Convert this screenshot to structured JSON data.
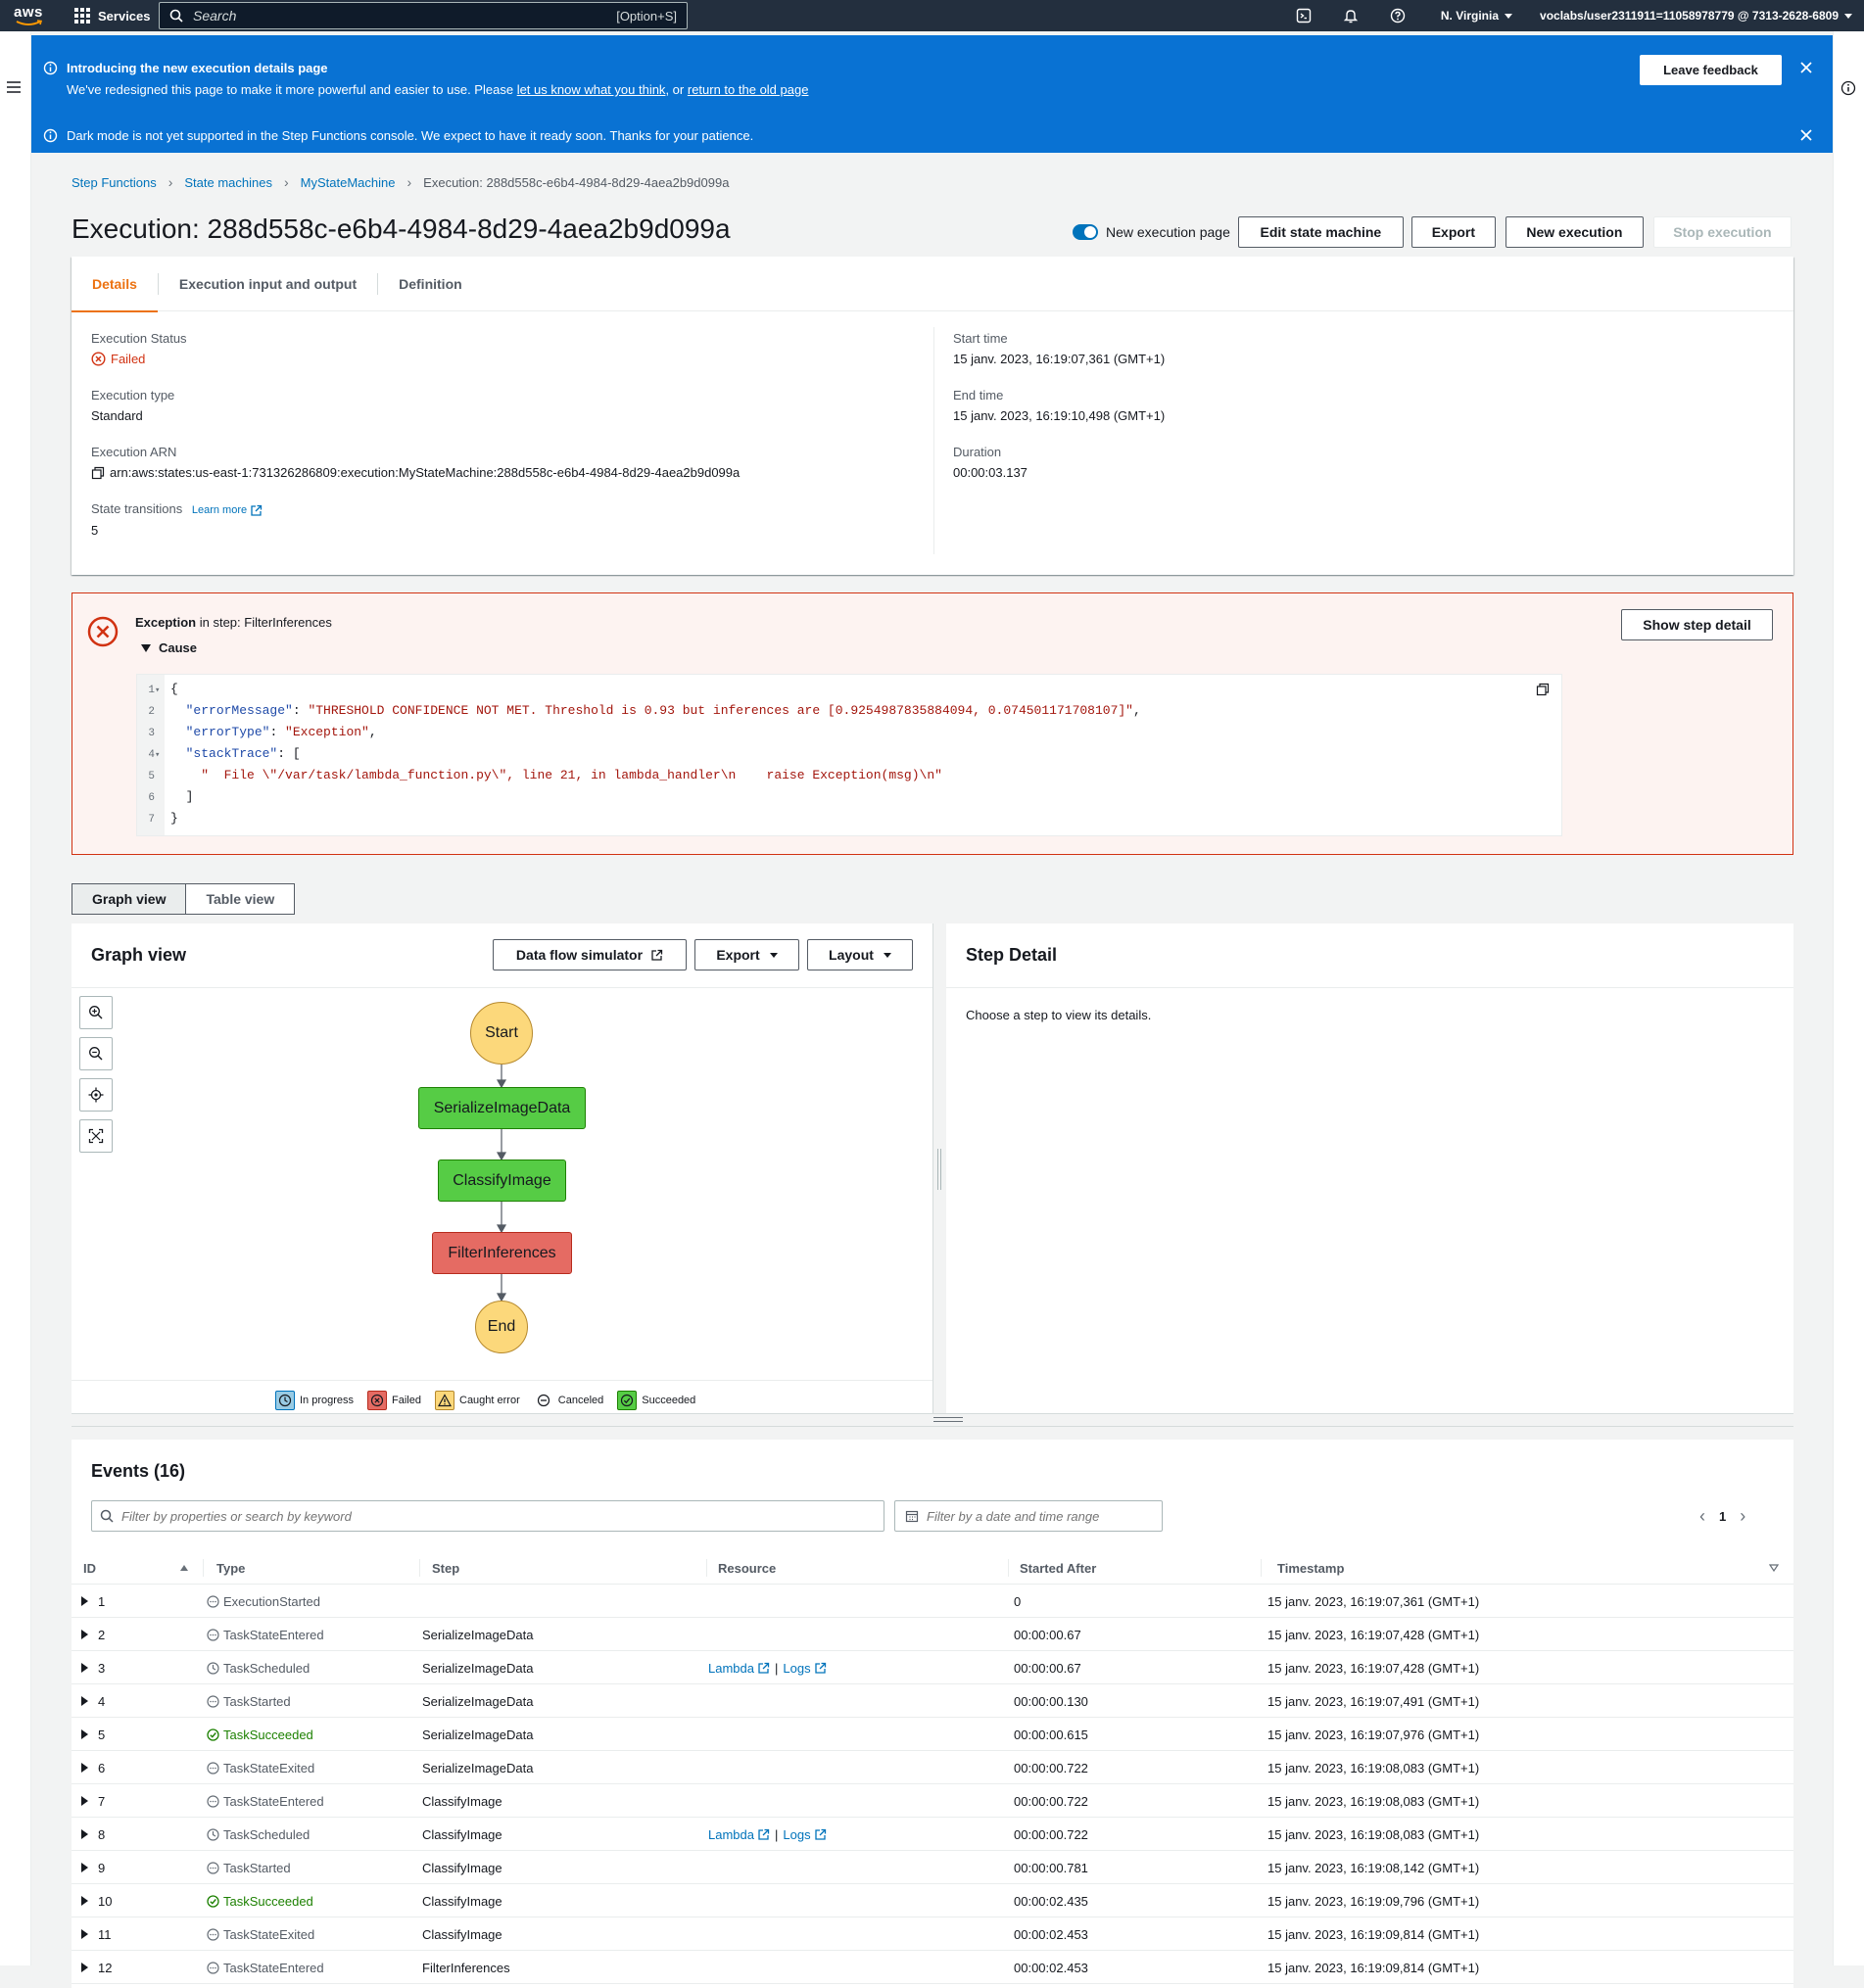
{
  "topnav": {
    "logo_text": "aws",
    "services_label": "Services",
    "search_placeholder": "Search",
    "search_shortcut": "[Option+S]",
    "region": "N. Virginia",
    "account": "voclabs/user2311911=11058978779 @ 7313-2628-6809"
  },
  "banners": {
    "intro_title": "Introducing the new execution details page",
    "intro_text": "We've redesigned this page to make it more powerful and easier to use. Please",
    "intro_link1": "let us know what you think",
    "intro_mid": ", or",
    "intro_link2": "return to the old page",
    "leave_feedback": "Leave feedback",
    "dark_mode_text": "Dark mode is not yet supported in the Step Functions console. We expect to have it ready soon. Thanks for your patience."
  },
  "breadcrumb": {
    "items": [
      "Step Functions",
      "State machines",
      "MyStateMachine"
    ],
    "current": "Execution: 288d558c-e6b4-4984-8d29-4aea2b9d099a"
  },
  "page": {
    "title": "Execution: 288d558c-e6b4-4984-8d29-4aea2b9d099a",
    "toggle_label": "New execution page",
    "edit_button": "Edit state machine",
    "export_button": "Export",
    "new_execution_button": "New execution",
    "stop_execution_button": "Stop execution"
  },
  "details": {
    "tabs": [
      "Details",
      "Execution input and output",
      "Definition"
    ],
    "status_label": "Execution Status",
    "status_value": "Failed",
    "type_label": "Execution type",
    "type_value": "Standard",
    "arn_label": "Execution ARN",
    "arn_value": "arn:aws:states:us-east-1:731326286809:execution:MyStateMachine:288d558c-e6b4-4984-8d29-4aea2b9d099a",
    "transitions_label": "State transitions",
    "learn_more": "Learn more",
    "transitions_value": "5",
    "start_label": "Start time",
    "start_value": "15 janv. 2023, 16:19:07,361 (GMT+1)",
    "end_label": "End time",
    "end_value": "15 janv. 2023, 16:19:10,498 (GMT+1)",
    "duration_label": "Duration",
    "duration_value": "00:00:03.137"
  },
  "exception": {
    "title_bold": "Exception",
    "title_rest": " in step: FilterInferences",
    "cause_label": "Cause",
    "show_step_detail": "Show step detail",
    "code_lines": [
      {
        "n": "1",
        "fold": "▾",
        "parts": [
          {
            "t": "{",
            "c": ""
          }
        ]
      },
      {
        "n": "2",
        "fold": "",
        "parts": [
          {
            "t": "  ",
            "c": ""
          },
          {
            "t": "\"errorMessage\"",
            "c": "key"
          },
          {
            "t": ": ",
            "c": ""
          },
          {
            "t": "\"THRESHOLD CONFIDENCE NOT MET. Threshold is 0.93 but inferences are [0.9254987835884094, 0.074501171708107]\"",
            "c": "str"
          },
          {
            "t": ",",
            "c": ""
          }
        ]
      },
      {
        "n": "3",
        "fold": "",
        "parts": [
          {
            "t": "  ",
            "c": ""
          },
          {
            "t": "\"errorType\"",
            "c": "key"
          },
          {
            "t": ": ",
            "c": ""
          },
          {
            "t": "\"Exception\"",
            "c": "str"
          },
          {
            "t": ",",
            "c": ""
          }
        ]
      },
      {
        "n": "4",
        "fold": "▾",
        "parts": [
          {
            "t": "  ",
            "c": ""
          },
          {
            "t": "\"stackTrace\"",
            "c": "key"
          },
          {
            "t": ": [",
            "c": ""
          }
        ]
      },
      {
        "n": "5",
        "fold": "",
        "parts": [
          {
            "t": "    ",
            "c": ""
          },
          {
            "t": "\"  File \\\"/var/task/lambda_function.py\\\", line 21, in lambda_handler\\n    raise Exception(msg)\\n\"",
            "c": "str"
          }
        ]
      },
      {
        "n": "6",
        "fold": "",
        "parts": [
          {
            "t": "  ]",
            "c": ""
          }
        ]
      },
      {
        "n": "7",
        "fold": "",
        "parts": [
          {
            "t": "}",
            "c": ""
          }
        ]
      }
    ]
  },
  "view_toggle": [
    "Graph view",
    "Table view"
  ],
  "graph": {
    "title": "Graph view",
    "data_flow_button": "Data flow simulator",
    "export_button": "Export",
    "layout_button": "Layout",
    "nodes": [
      {
        "label": "Start",
        "status": "terminal"
      },
      {
        "label": "SerializeImageData",
        "status": "succeeded"
      },
      {
        "label": "ClassifyImage",
        "status": "succeeded"
      },
      {
        "label": "FilterInferences",
        "status": "failed"
      },
      {
        "label": "End",
        "status": "terminal"
      }
    ],
    "legend": [
      "In progress",
      "Failed",
      "Caught error",
      "Canceled",
      "Succeeded"
    ]
  },
  "step_detail": {
    "title": "Step Detail",
    "empty_text": "Choose a step to view its details."
  },
  "events": {
    "title": "Events (16)",
    "filter_placeholder": "Filter by properties or search by keyword",
    "date_placeholder": "Filter by a date and time range",
    "page_number": "1",
    "columns": [
      "ID",
      "Type",
      "Step",
      "Resource",
      "Started After",
      "Timestamp"
    ],
    "resource_lambda": "Lambda",
    "resource_logs": "Logs",
    "rows": [
      {
        "id": "1",
        "type": "ExecutionStarted",
        "status": "neutral",
        "step": "",
        "resource": false,
        "after": "0",
        "ts": "15 janv. 2023, 16:19:07,361 (GMT+1)"
      },
      {
        "id": "2",
        "type": "TaskStateEntered",
        "status": "neutral",
        "step": "SerializeImageData",
        "resource": false,
        "after": "00:00:00.67",
        "ts": "15 janv. 2023, 16:19:07,428 (GMT+1)"
      },
      {
        "id": "3",
        "type": "TaskScheduled",
        "status": "clock",
        "step": "SerializeImageData",
        "resource": true,
        "after": "00:00:00.67",
        "ts": "15 janv. 2023, 16:19:07,428 (GMT+1)"
      },
      {
        "id": "4",
        "type": "TaskStarted",
        "status": "neutral",
        "step": "SerializeImageData",
        "resource": false,
        "after": "00:00:00.130",
        "ts": "15 janv. 2023, 16:19:07,491 (GMT+1)"
      },
      {
        "id": "5",
        "type": "TaskSucceeded",
        "status": "success",
        "step": "SerializeImageData",
        "resource": false,
        "after": "00:00:00.615",
        "ts": "15 janv. 2023, 16:19:07,976 (GMT+1)"
      },
      {
        "id": "6",
        "type": "TaskStateExited",
        "status": "neutral",
        "step": "SerializeImageData",
        "resource": false,
        "after": "00:00:00.722",
        "ts": "15 janv. 2023, 16:19:08,083 (GMT+1)"
      },
      {
        "id": "7",
        "type": "TaskStateEntered",
        "status": "neutral",
        "step": "ClassifyImage",
        "resource": false,
        "after": "00:00:00.722",
        "ts": "15 janv. 2023, 16:19:08,083 (GMT+1)"
      },
      {
        "id": "8",
        "type": "TaskScheduled",
        "status": "clock",
        "step": "ClassifyImage",
        "resource": true,
        "after": "00:00:00.722",
        "ts": "15 janv. 2023, 16:19:08,083 (GMT+1)"
      },
      {
        "id": "9",
        "type": "TaskStarted",
        "status": "neutral",
        "step": "ClassifyImage",
        "resource": false,
        "after": "00:00:00.781",
        "ts": "15 janv. 2023, 16:19:08,142 (GMT+1)"
      },
      {
        "id": "10",
        "type": "TaskSucceeded",
        "status": "success",
        "step": "ClassifyImage",
        "resource": false,
        "after": "00:00:02.435",
        "ts": "15 janv. 2023, 16:19:09,796 (GMT+1)"
      },
      {
        "id": "11",
        "type": "TaskStateExited",
        "status": "neutral",
        "step": "ClassifyImage",
        "resource": false,
        "after": "00:00:02.453",
        "ts": "15 janv. 2023, 16:19:09,814 (GMT+1)"
      },
      {
        "id": "12",
        "type": "TaskStateEntered",
        "status": "neutral",
        "step": "FilterInferences",
        "resource": false,
        "after": "00:00:02.453",
        "ts": "15 janv. 2023, 16:19:09,814 (GMT+1)"
      }
    ]
  }
}
